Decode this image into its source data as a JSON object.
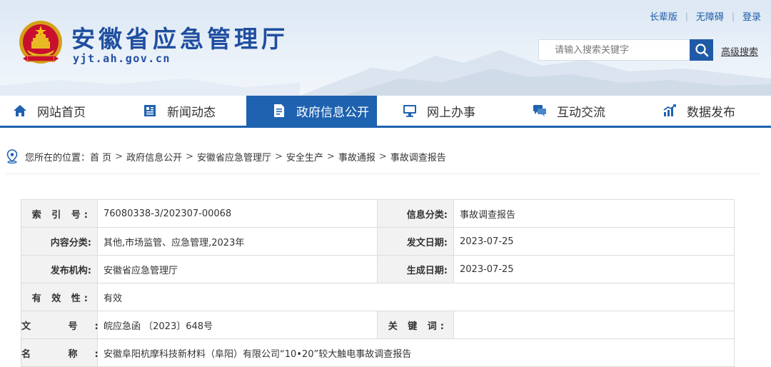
{
  "header": {
    "site_title": "安徽省应急管理厅",
    "site_domain": "yjt.ah.gov.cn",
    "top_links": [
      "长辈版",
      "无障碍",
      "登录"
    ],
    "search_placeholder": "请输入搜索关键字",
    "advanced_search": "高级搜索"
  },
  "nav": {
    "items": [
      {
        "label": "网站首页",
        "icon": "home-icon"
      },
      {
        "label": "新闻动态",
        "icon": "newspaper-icon"
      },
      {
        "label": "政府信息公开",
        "icon": "document-icon",
        "active": true
      },
      {
        "label": "网上办事",
        "icon": "monitor-icon"
      },
      {
        "label": "互动交流",
        "icon": "chat-icon"
      },
      {
        "label": "数据发布",
        "icon": "chart-icon"
      }
    ]
  },
  "breadcrumb": {
    "prefix": "您所在的位置：",
    "items": [
      "首 页",
      "政府信息公开",
      "安徽省应急管理厅",
      "安全生产",
      "事故通报",
      "事故调查报告"
    ],
    "separator": ">"
  },
  "info": {
    "index_label": "索 引 号:",
    "index_value": "76080338-3/202307-00068",
    "category_label": "信息分类:",
    "category_value": "事故调查报告",
    "content_label": "内容分类:",
    "content_value": "其他,市场监管、应急管理,2023年",
    "issue_date_label": "发文日期:",
    "issue_date_value": "2023-07-25",
    "publisher_label": "发布机构:",
    "publisher_value": "安徽省应急管理厅",
    "gen_date_label": "生成日期:",
    "gen_date_value": "2023-07-25",
    "validity_label": "有 效 性:",
    "validity_value": "有效",
    "doc_no_label": "文 号:",
    "doc_no_value": "皖应急函 〔2023〕648号",
    "keywords_label": "关 键 词:",
    "keywords_value": "",
    "name_label": "名 称:",
    "name_value": "安徽阜阳杭摩科技新材料（阜阳）有限公司“10•20”较大触电事故调查报告"
  },
  "colors": {
    "brand_blue": "#1e62b0",
    "title_blue": "#1f4ea0",
    "label_bg": "#f2f2f2"
  }
}
